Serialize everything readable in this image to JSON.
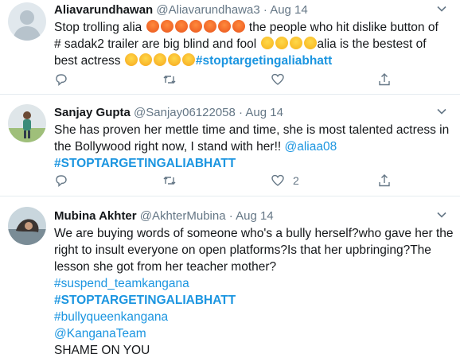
{
  "tweets": [
    {
      "name": "Aliavarundhawan",
      "handle": "@Aliavarundhawa3",
      "date": "Aug 14",
      "body": {
        "l1a": "Stop trolling alia",
        "l1b": "the people who hit dislike button of",
        "l2a": "# sadak2 trailer are big blind and fool",
        "l2b": "alia is the bestest of",
        "l3a": "best actress",
        "l3tag": "#stoptargetingaliabhatt"
      },
      "likes": ""
    },
    {
      "name": "Sanjay Gupta",
      "handle": "@Sanjay06122058",
      "date": "Aug 14",
      "body": {
        "l1": "She has proven her mettle time and time, she is most talented actress in",
        "l2a": "the Bollywood right now, I stand with her!!",
        "l2mention": "@aliaa08",
        "l3tag": "#STOPTARGETINGALIABHATT"
      },
      "likes": "2"
    },
    {
      "name": "Mubina Akhter",
      "handle": "@AkhterMubina",
      "date": "Aug 14",
      "body": {
        "l1": "We are buying words of someone who's a bully herself?who gave her the",
        "l2": "right to insult everyone on open platforms?Is that her upbringing?The",
        "l3": "lesson she got from her teacher mother?",
        "tag1": "#suspend_teamkangana",
        "tag2": "#STOPTARGETINGALIABHATT",
        "tag3": "#bullyqueenkangana",
        "mention": "@KanganaTeam",
        "last": "SHAME ON YOU"
      }
    }
  ],
  "separator": "·",
  "icons": {
    "reply": "reply-icon",
    "retweet": "retweet-icon",
    "like": "heart-icon",
    "share": "share-icon",
    "menu": "chevron-down-icon"
  },
  "colors": {
    "link": "#1b95e0",
    "muted": "#657786",
    "text": "#14171a",
    "border": "#e6ecf0"
  }
}
